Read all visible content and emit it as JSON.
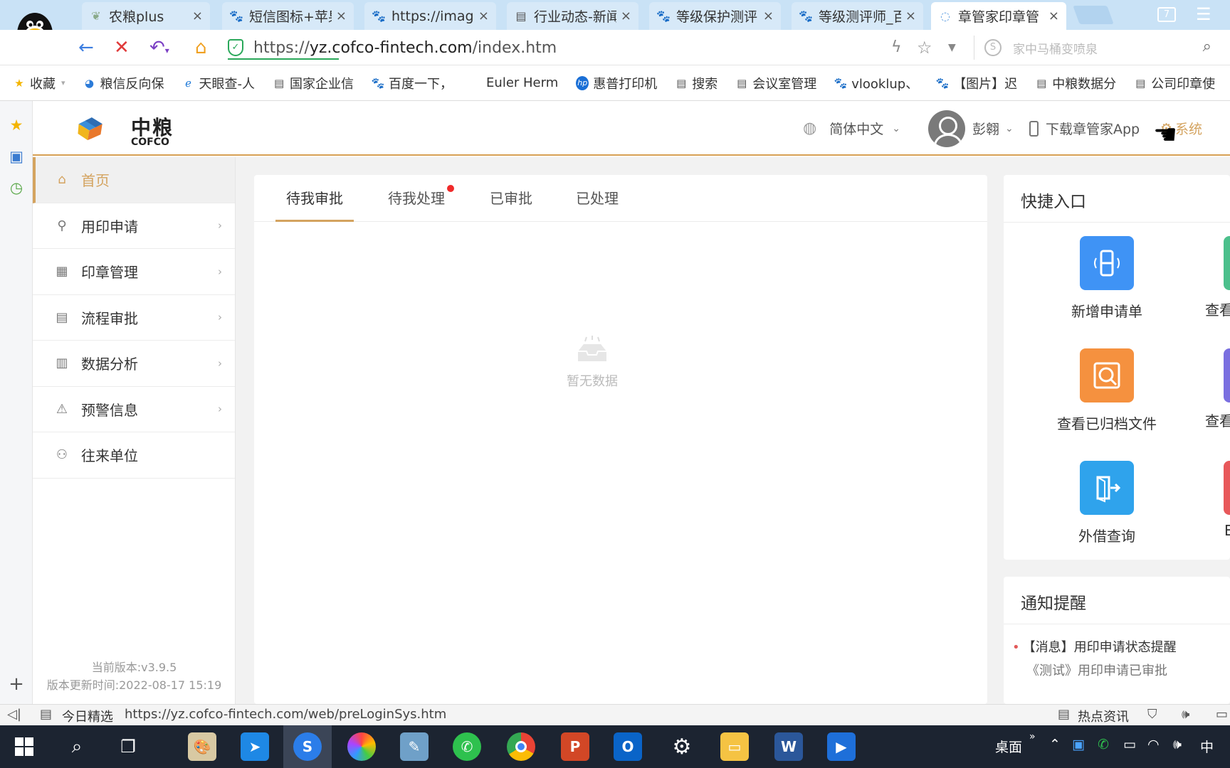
{
  "browser": {
    "tabs": [
      {
        "title": "农粮plus",
        "icon": "leaf"
      },
      {
        "title": "短信图标+苹果",
        "icon": "baidu-paw"
      },
      {
        "title": "https://imag",
        "icon": "baidu-paw"
      },
      {
        "title": "行业动态-新闻",
        "icon": "doc"
      },
      {
        "title": "等级保护测评",
        "icon": "baidu-paw"
      },
      {
        "title": "等级测评师_百",
        "icon": "baidu-paw"
      },
      {
        "title": "章管家印章管",
        "icon": "loading"
      }
    ],
    "tab_close": "×",
    "tab_count": "7",
    "url": {
      "prefix": "https://",
      "host": "yz.cofco-fintech.com",
      "path": "/index.htm"
    },
    "search_placeholder": "家中马桶变喷泉",
    "bookmarks": [
      {
        "label": "收藏",
        "icon": "star"
      },
      {
        "label": "粮信反向保",
        "icon": "globe"
      },
      {
        "label": "天眼查-人",
        "icon": "e-logo"
      },
      {
        "label": "国家企业信",
        "icon": "doc"
      },
      {
        "label": "百度一下，",
        "icon": "baidu-paw"
      },
      {
        "label": "Euler Herm",
        "icon": "none"
      },
      {
        "label": "惠普打印机",
        "icon": "hp"
      },
      {
        "label": "搜索",
        "icon": "doc"
      },
      {
        "label": "会议室管理",
        "icon": "doc"
      },
      {
        "label": "vlooklup、",
        "icon": "baidu-paw"
      },
      {
        "label": "【图片】迟",
        "icon": "baidu-paw"
      },
      {
        "label": "中粮数据分",
        "icon": "doc"
      },
      {
        "label": "公司印章使",
        "icon": "doc"
      }
    ],
    "status_url": "https://yz.cofco-fintech.com/web/preLoginSys.htm",
    "status_left_label": "今日精选",
    "status_right_label": "热点资讯"
  },
  "app": {
    "brand_cn": "中粮",
    "brand_en": "COFCO",
    "language": "简体中文",
    "user": "彭翱",
    "download_app": "下载章管家App",
    "system": "系统",
    "sidebar": [
      {
        "label": "首页",
        "icon": "home-icon",
        "active": true
      },
      {
        "label": "用印申请",
        "icon": "stamp-icon"
      },
      {
        "label": "印章管理",
        "icon": "grid-icon"
      },
      {
        "label": "流程审批",
        "icon": "form-icon"
      },
      {
        "label": "数据分析",
        "icon": "bar-chart-icon"
      },
      {
        "label": "预警信息",
        "icon": "alert-icon"
      },
      {
        "label": "往来单位",
        "icon": "users-icon"
      }
    ],
    "version": "当前版本:v3.9.5",
    "update_time": "版本更新时间:2022-08-17 15:19",
    "tabs": [
      "待我审批",
      "待我处理",
      "已审批",
      "已处理"
    ],
    "empty_text": "暂无数据",
    "quick_title": "快捷入口",
    "quick_items": [
      {
        "label": "新增申请单",
        "color": "#3f93f5"
      },
      {
        "label": "查看已归档文件",
        "color": "#f5913f"
      },
      {
        "label": "外借查询",
        "color": "#2fa3ec"
      }
    ],
    "quick_peek_labels": [
      "查看",
      "查看",
      "E"
    ],
    "quick_peek_colors": [
      "#4cc08c",
      "#7a6fe0",
      "#e8585a"
    ],
    "notice_title": "通知提醒",
    "notice_line1": "【消息】用印申请状态提醒",
    "notice_line2": "《测试》用印申请已审批"
  },
  "taskbar": {
    "desktop_label": "桌面",
    "ime": "中"
  },
  "colors": {
    "accent": "#d4a35f",
    "badge": "#f02a2a"
  }
}
